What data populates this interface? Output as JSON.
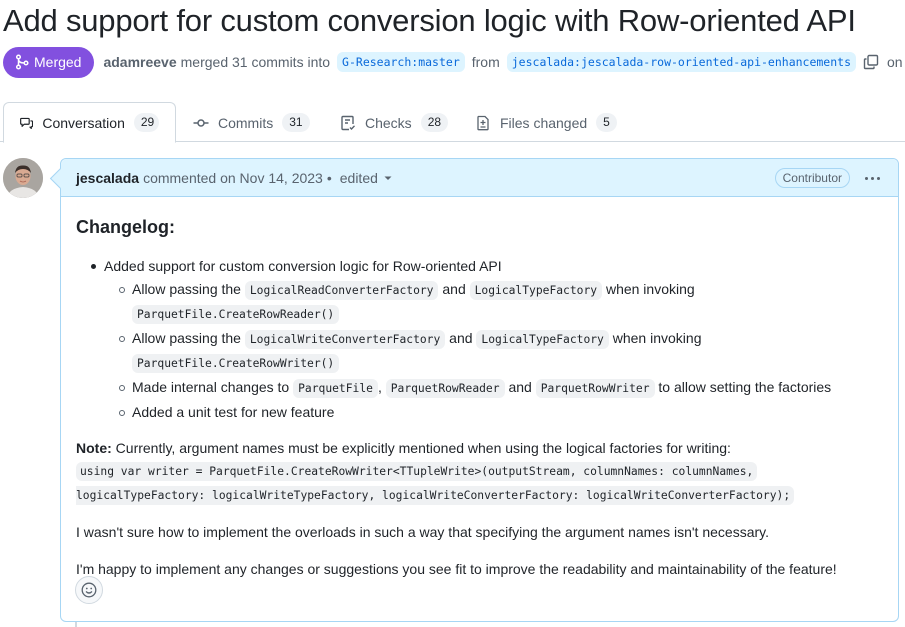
{
  "pr": {
    "title": "Add support for custom conversion logic with Row-oriented API",
    "state": "Merged",
    "merged_by": "adamreeve",
    "merged_text": "merged 31 commits into",
    "base_branch": "G-Research:master",
    "from_text": "from",
    "head_branch": "jescalada:jescalada-row-oriented-api-enhancements",
    "date_prefix": "on No"
  },
  "tabs": [
    {
      "label": "Conversation",
      "count": "29",
      "icon": "comment-discussion-icon",
      "active": true
    },
    {
      "label": "Commits",
      "count": "31",
      "icon": "git-commit-icon",
      "active": false
    },
    {
      "label": "Checks",
      "count": "28",
      "icon": "checklist-icon",
      "active": false
    },
    {
      "label": "Files changed",
      "count": "5",
      "icon": "file-diff-icon",
      "active": false
    }
  ],
  "comment": {
    "author": "jescalada",
    "action": "commented on Nov 14, 2023",
    "separator": "•",
    "edited": "edited",
    "role": "Contributor",
    "heading": "Changelog:",
    "bullet": "Added support for custom conversion logic for Row-oriented API",
    "sub1": {
      "t1": "Allow passing the",
      "c1": "LogicalReadConverterFactory",
      "t2": "and",
      "c2": "LogicalTypeFactory",
      "t3": "when invoking",
      "c3": "ParquetFile.CreateRowReader()"
    },
    "sub2": {
      "t1": "Allow passing the",
      "c1": "LogicalWriteConverterFactory",
      "t2": "and",
      "c2": "LogicalTypeFactory",
      "t3": "when invoking",
      "c3": "ParquetFile.CreateRowWriter()"
    },
    "sub3": {
      "t1": "Made internal changes to",
      "c1": "ParquetFile",
      "t2": ",",
      "c2": "ParquetRowReader",
      "t3": "and",
      "c3": "ParquetRowWriter",
      "t4": "to allow setting the factories"
    },
    "sub4": "Added a unit test for new feature",
    "note_label": "Note:",
    "note_text": "Currently, argument names must be explicitly mentioned when using the logical factories for writing:",
    "code_line1": "using var writer = ParquetFile.CreateRowWriter<TTupleWrite>(outputStream, columnNames: columnNames,",
    "code_line2": "logicalTypeFactory: logicalWriteTypeFactory, logicalWriteConverterFactory: logicalWriteConverterFactory);",
    "para1": "I wasn't sure how to implement the overloads in such a way that specifying the argument names isn't necessary.",
    "para2": "I'm happy to implement any changes or suggestions you see fit to improve the readability and maintainability of the feature!"
  },
  "colors": {
    "merged": "#8250df",
    "branch_bg": "#ddf4ff",
    "branch_fg": "#0969da",
    "comment_header_bg": "#ddf4ff",
    "comment_border": "#a7d6f4"
  }
}
